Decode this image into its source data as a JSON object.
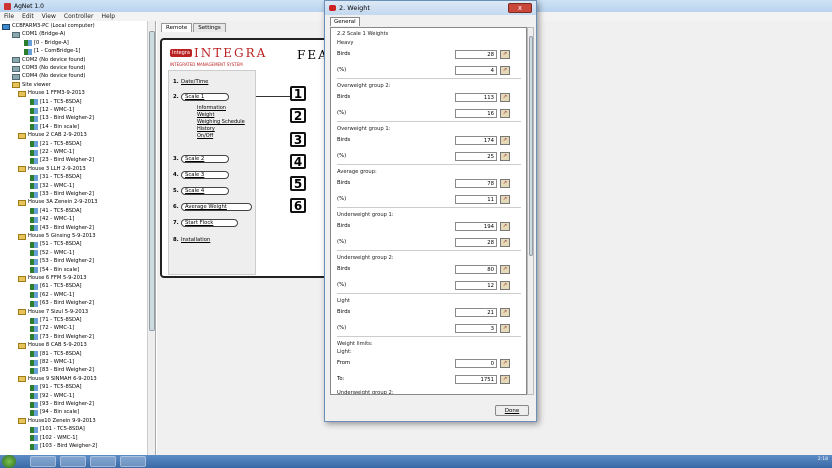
{
  "window": {
    "title": "AgNet 1.0"
  },
  "menu": [
    "File",
    "Edit",
    "View",
    "Controller",
    "Help"
  ],
  "tree": [
    {
      "label": "CCBFARM3-PC (Local computer)",
      "icon": "pc"
    },
    {
      "label": "COM1 (Bridge-A)",
      "icon": "port"
    },
    {
      "label": "[0 - Bridge-A]",
      "icon": "dev"
    },
    {
      "label": "[1 - ComBridge-1]",
      "icon": "dev"
    },
    {
      "label": "COM2 (No device found)",
      "icon": "port"
    },
    {
      "label": "COM3 (No device found)",
      "icon": "port"
    },
    {
      "label": "COM4 (No device found)",
      "icon": "port"
    },
    {
      "label": "Site viewer",
      "icon": "house"
    },
    {
      "label": "House 1 FFM3-9-2013",
      "icon": "house"
    },
    {
      "label": "[11 - TC5-8SDA]",
      "icon": "dev"
    },
    {
      "label": "[12 - WMC-1]",
      "icon": "dev"
    },
    {
      "label": "[13 - Bird Weigher-2]",
      "icon": "dev"
    },
    {
      "label": "[14 - Bin scale]",
      "icon": "dev"
    },
    {
      "label": "House 2 CAB 2-9-2013",
      "icon": "house"
    },
    {
      "label": "[21 - TC5-8SDA]",
      "icon": "dev"
    },
    {
      "label": "[22 - WMC-1]",
      "icon": "dev"
    },
    {
      "label": "[23 - Bird Weigher-2]",
      "icon": "dev"
    },
    {
      "label": "House 3 LLH 2-9-2013",
      "icon": "house"
    },
    {
      "label": "[31 - TC5-8SDA]",
      "icon": "dev"
    },
    {
      "label": "[32 - WMC-1]",
      "icon": "dev"
    },
    {
      "label": "[33 - Bird Weigher-2]",
      "icon": "dev"
    },
    {
      "label": "House 3A Zenein 2-9-2013",
      "icon": "house"
    },
    {
      "label": "[41 - TC5-8SDA]",
      "icon": "dev"
    },
    {
      "label": "[42 - WMC-1]",
      "icon": "dev"
    },
    {
      "label": "[43 - Bird Weigher-2]",
      "icon": "dev"
    },
    {
      "label": "House 5 Ginsing 5-9-2013",
      "icon": "house"
    },
    {
      "label": "[51 - TC5-8SDA]",
      "icon": "dev"
    },
    {
      "label": "[52 - WMC-1]",
      "icon": "dev"
    },
    {
      "label": "[53 - Bird Weigher-2]",
      "icon": "dev"
    },
    {
      "label": "[54 - Bin scale]",
      "icon": "dev"
    },
    {
      "label": "House 6 FFM 5-9-2013",
      "icon": "house"
    },
    {
      "label": "[61 - TC5-8SDA]",
      "icon": "dev"
    },
    {
      "label": "[62 - WMC-1]",
      "icon": "dev"
    },
    {
      "label": "[63 - Bird Weigher-2]",
      "icon": "dev"
    },
    {
      "label": "House 7 Sizul 5-9-2013",
      "icon": "house"
    },
    {
      "label": "[71 - TC5-8SDA]",
      "icon": "dev"
    },
    {
      "label": "[72 - WMC-1]",
      "icon": "dev"
    },
    {
      "label": "[73 - Bird Weigher-2]",
      "icon": "dev"
    },
    {
      "label": "House 8 CAB 5-9-2013",
      "icon": "house"
    },
    {
      "label": "[81 - TC5-8SDA]",
      "icon": "dev"
    },
    {
      "label": "[82 - WMC-1]",
      "icon": "dev"
    },
    {
      "label": "[83 - Bird Weigher-2]",
      "icon": "dev"
    },
    {
      "label": "House 9 SINMAH 6-9-2013",
      "icon": "house"
    },
    {
      "label": "[91 - TC5-8SDA]",
      "icon": "dev"
    },
    {
      "label": "[92 - WMC-1]",
      "icon": "dev"
    },
    {
      "label": "[93 - Bird Weigher-2]",
      "icon": "dev"
    },
    {
      "label": "[94 - Bin scale]",
      "icon": "dev"
    },
    {
      "label": "House10 Zenein 9-9-2013",
      "icon": "house"
    },
    {
      "label": "[101 - TC5-8SDA]",
      "icon": "dev"
    },
    {
      "label": "[102 - WMC-1]",
      "icon": "dev"
    },
    {
      "label": "[103 - Bird Weigher-2]",
      "icon": "dev"
    }
  ],
  "right": {
    "tabs": [
      "Remote",
      "Settings"
    ],
    "logo_badge": "Integra",
    "logo": "INTEGRA",
    "logo_sub": "INTEGRATED MANAGEMENT SYSTEM",
    "feat": "FEAT",
    "menu": [
      {
        "n": "1.",
        "label": "Date/Time"
      },
      {
        "n": "2.",
        "label": "Scale 1"
      },
      {
        "n": "3.",
        "label": "Scale 2"
      },
      {
        "n": "4.",
        "label": "Scale 3"
      },
      {
        "n": "5.",
        "label": "Scale 4"
      },
      {
        "n": "6.",
        "label": "Average Weight"
      },
      {
        "n": "7.",
        "label": "Start Flock"
      },
      {
        "n": "8.",
        "label": "Installation"
      }
    ],
    "submenu": [
      "Information",
      "Weight",
      "Weighing Schedule",
      "History",
      "On/Off"
    ],
    "numbers": [
      "1",
      "2",
      "3",
      "4",
      "5",
      "6"
    ]
  },
  "dialog": {
    "title": "2. Weight",
    "tab": "General",
    "section": "2.2 Scale 1 Weights",
    "groups": [
      {
        "name": "Heavy",
        "rows": [
          {
            "label": "Birds",
            "value": "28"
          },
          {
            "label": "(%)",
            "value": "4"
          }
        ]
      },
      {
        "name": "Overweight group 2:",
        "rows": [
          {
            "label": "Birds",
            "value": "113"
          },
          {
            "label": "(%)",
            "value": "16"
          }
        ]
      },
      {
        "name": "Overweight group 1:",
        "rows": [
          {
            "label": "Birds",
            "value": "174"
          },
          {
            "label": "(%)",
            "value": "25"
          }
        ]
      },
      {
        "name": "Average group:",
        "rows": [
          {
            "label": "Birds",
            "value": "78"
          },
          {
            "label": "(%)",
            "value": "11"
          }
        ]
      },
      {
        "name": "Underweight group 1:",
        "rows": [
          {
            "label": "Birds",
            "value": "194"
          },
          {
            "label": "(%)",
            "value": "28"
          }
        ]
      },
      {
        "name": "Underweight group 2:",
        "rows": [
          {
            "label": "Birds",
            "value": "80"
          },
          {
            "label": "(%)",
            "value": "12"
          }
        ]
      },
      {
        "name": "Light",
        "rows": [
          {
            "label": "Birds",
            "value": "21"
          },
          {
            "label": "(%)",
            "value": "3"
          }
        ]
      }
    ],
    "limits": {
      "title": "Weight limits:",
      "light": "Light:",
      "from_label": "From",
      "from_value": "0",
      "to_label": "To:",
      "to_value": "1751",
      "uw2": "Underweight group 2:"
    },
    "done": "Done",
    "close": "x"
  },
  "taskbar": {
    "clock": "2:18"
  }
}
